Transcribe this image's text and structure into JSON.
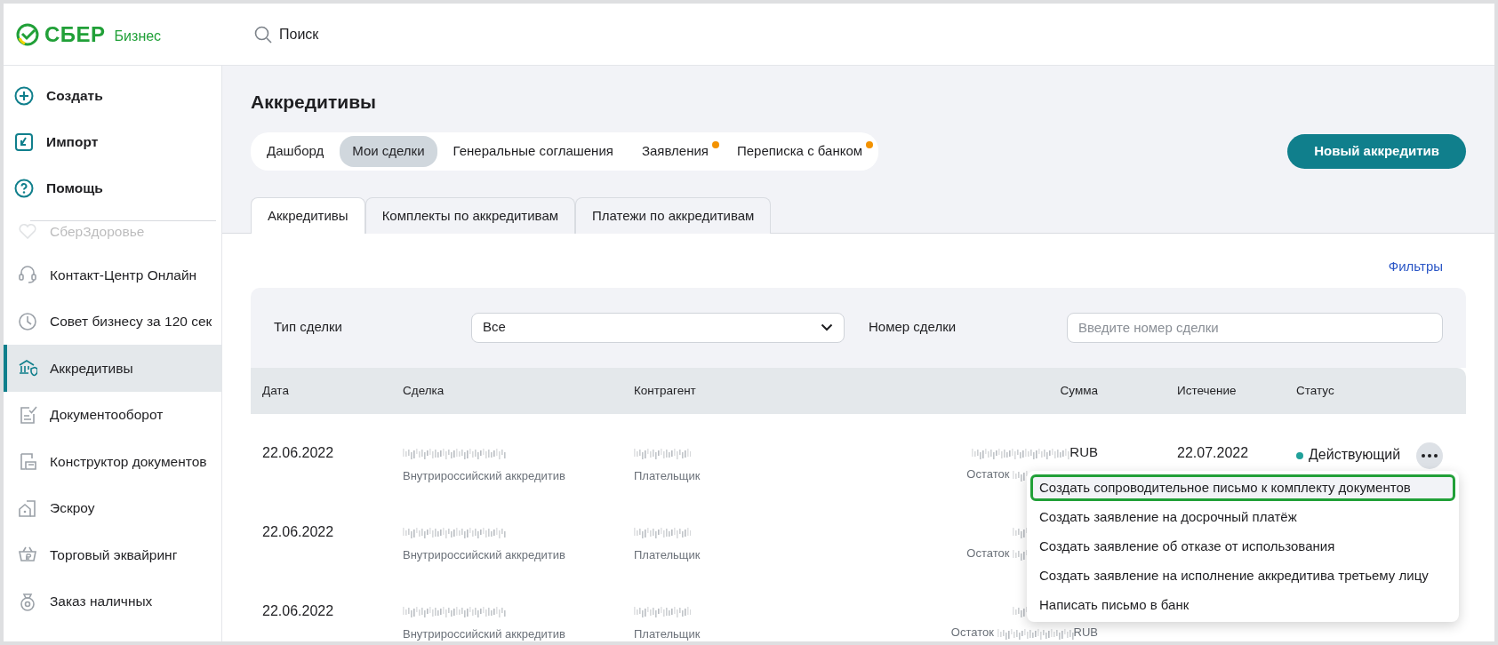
{
  "logo": {
    "brand": "СБЕР",
    "product": "Бизнес"
  },
  "search": {
    "placeholder": "Поиск"
  },
  "sidebar": {
    "actions": [
      {
        "label": "Создать"
      },
      {
        "label": "Импорт"
      },
      {
        "label": "Помощь"
      }
    ],
    "items": [
      {
        "label": "СберЗдоровье",
        "selected": false,
        "faded": true
      },
      {
        "label": "Контакт-Центр Онлайн",
        "selected": false,
        "faded": false
      },
      {
        "label": "Совет бизнесу за 120 сек",
        "selected": false,
        "faded": false
      },
      {
        "label": "Аккредитивы",
        "selected": true,
        "faded": false
      },
      {
        "label": "Документооборот",
        "selected": false,
        "faded": false
      },
      {
        "label": "Конструктор документов",
        "selected": false,
        "faded": false
      },
      {
        "label": "Эскроу",
        "selected": false,
        "faded": false
      },
      {
        "label": "Торговый эквайринг",
        "selected": false,
        "faded": false
      },
      {
        "label": "Заказ наличных",
        "selected": false,
        "faded": false
      }
    ]
  },
  "page": {
    "title": "Аккредитивы",
    "new_button": "Новый аккредитив",
    "sections": [
      {
        "label": "Дашборд",
        "selected": false,
        "notify": false
      },
      {
        "label": "Мои сделки",
        "selected": true,
        "notify": false
      },
      {
        "label": "Генеральные соглашения",
        "selected": false,
        "notify": false
      },
      {
        "label": "Заявления",
        "selected": false,
        "notify": true
      },
      {
        "label": "Переписка с банком",
        "selected": false,
        "notify": true
      }
    ],
    "tabs": [
      {
        "label": "Аккредитивы",
        "selected": true
      },
      {
        "label": "Комплекты по аккредитивам",
        "selected": false
      },
      {
        "label": "Платежи по аккредитивам",
        "selected": false
      }
    ],
    "filters_link": "Фильтры",
    "filters": {
      "deal_type_label": "Тип сделки",
      "deal_type_value": "Все",
      "deal_number_label": "Номер сделки",
      "deal_number_placeholder": "Введите номер сделки"
    }
  },
  "table": {
    "columns": [
      "Дата",
      "Сделка",
      "Контрагент",
      "Сумма",
      "Истечение",
      "Статус"
    ],
    "rows": [
      {
        "date": "22.06.2022",
        "deal_type": "Внутрироссийский аккредитив",
        "role": "Плательщик",
        "amount_currency": "RUB",
        "remainder_label": "Остаток",
        "expiry": "22.07.2022",
        "status": "Действующий",
        "color": "#21a19a",
        "menu_open": true
      },
      {
        "date": "22.06.2022",
        "deal_type": "Внутрироссийский аккредитив",
        "role": "Плательщик",
        "remainder_label": "Остаток"
      },
      {
        "date": "22.06.2022",
        "deal_type": "Внутрироссийский аккредитив",
        "role": "Плательщик",
        "remainder_label": "Остаток",
        "remainder_currency": "RUB"
      }
    ]
  },
  "row_menu": {
    "items": [
      {
        "label": "Создать сопроводительное письмо к комплекту документов",
        "selected": true
      },
      {
        "label": "Создать заявление на досрочный платёж",
        "selected": false
      },
      {
        "label": "Создать заявление об отказе от использования",
        "selected": false
      },
      {
        "label": "Создать заявление на исполнение аккредитива третьему лицу",
        "selected": false
      },
      {
        "label": "Написать письмо в банк",
        "selected": false
      }
    ]
  }
}
